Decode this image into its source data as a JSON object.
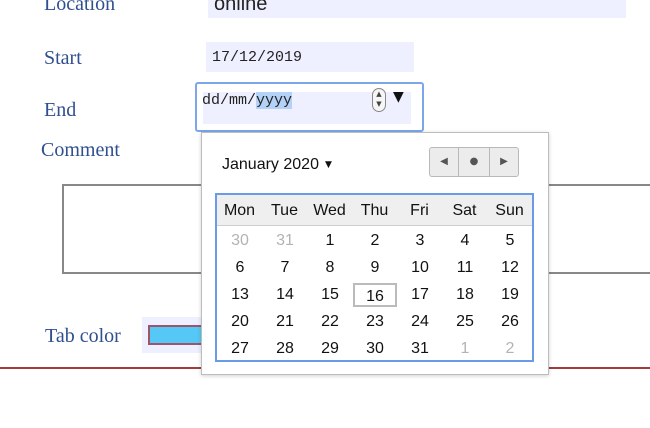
{
  "form": {
    "location": {
      "label": "Location",
      "value": "online"
    },
    "start": {
      "label": "Start",
      "value": "17/12/2019"
    },
    "end": {
      "label": "End",
      "value_prefix": "dd/mm/",
      "value_selected": "yyyy"
    },
    "comment": {
      "label": "Comment",
      "value": ""
    },
    "tab_color": {
      "label": "Tab color",
      "value": "#55c8f5"
    }
  },
  "calendar": {
    "month_label": "January 2020",
    "nav": {
      "prev": "◀",
      "today": "●",
      "next": "▶"
    },
    "weekdays": [
      "Mon",
      "Tue",
      "Wed",
      "Thu",
      "Fri",
      "Sat",
      "Sun"
    ],
    "weeks": [
      [
        {
          "d": "30",
          "other": true
        },
        {
          "d": "31",
          "other": true
        },
        {
          "d": "1"
        },
        {
          "d": "2"
        },
        {
          "d": "3"
        },
        {
          "d": "4"
        },
        {
          "d": "5"
        }
      ],
      [
        {
          "d": "6"
        },
        {
          "d": "7"
        },
        {
          "d": "8"
        },
        {
          "d": "9"
        },
        {
          "d": "10"
        },
        {
          "d": "11"
        },
        {
          "d": "12"
        }
      ],
      [
        {
          "d": "13"
        },
        {
          "d": "14"
        },
        {
          "d": "15"
        },
        {
          "d": "16",
          "today": true
        },
        {
          "d": "17"
        },
        {
          "d": "18"
        },
        {
          "d": "19"
        }
      ],
      [
        {
          "d": "20"
        },
        {
          "d": "21"
        },
        {
          "d": "22"
        },
        {
          "d": "23"
        },
        {
          "d": "24"
        },
        {
          "d": "25"
        },
        {
          "d": "26"
        }
      ],
      [
        {
          "d": "27"
        },
        {
          "d": "28"
        },
        {
          "d": "29"
        },
        {
          "d": "30"
        },
        {
          "d": "31"
        },
        {
          "d": "1",
          "other": true
        },
        {
          "d": "2",
          "other": true
        }
      ]
    ]
  },
  "colors": {
    "label_text": "#2f4f8f",
    "field_bg": "#eef0ff",
    "focus_ring": "#7ba6ea",
    "selection": "#b4d2f7",
    "rule": "#a33b3b"
  },
  "icons": {
    "stepper": "spin-buttons-icon",
    "dropdown": "triangle-down-icon"
  }
}
